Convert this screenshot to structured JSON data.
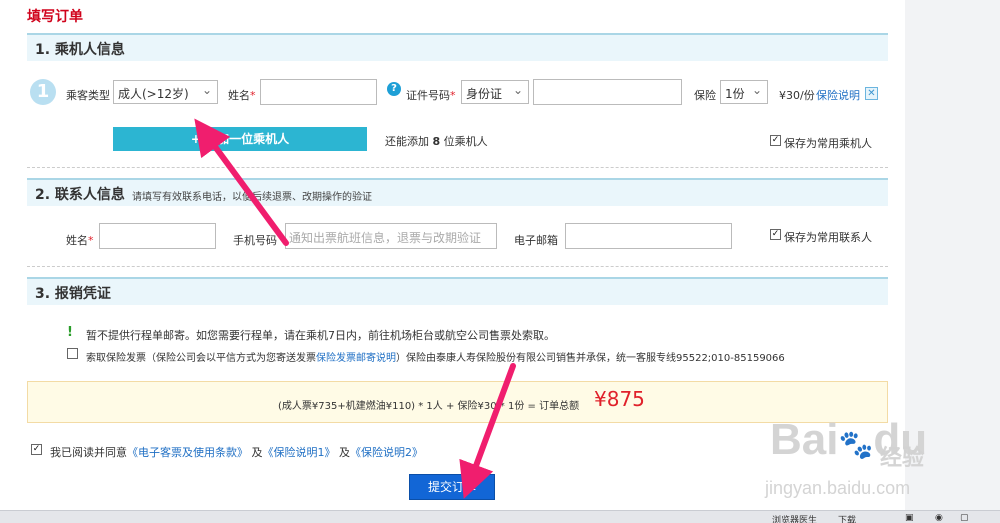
{
  "page": {
    "title": "填写订单"
  },
  "passenger": {
    "section_label": "1. 乘机人信息",
    "step_number": "1",
    "type_label": "乘客类型",
    "type_value": "成人(>12岁)",
    "name_label": "姓名",
    "required_mark": "*",
    "id_label": "证件号码",
    "id_type_value": "身份证",
    "insurance_label": "保险",
    "insurance_value": "1份",
    "insurance_price": "¥30/份",
    "insurance_link": "保险说明",
    "add_button": "添加一位乘机人",
    "add_button_plus": "+",
    "remaining_prefix": "还能添加",
    "remaining_count": "8",
    "remaining_suffix": "位乘机人",
    "save_label": "保存为常用乘机人"
  },
  "contact": {
    "section_label": "2. 联系人信息",
    "section_note": "请填写有效联系电话，以便后续退票、改期操作的验证",
    "name_label": "姓名",
    "phone_label": "手机号码",
    "phone_placeholder": "通知出票航班信息，退票与改期验证",
    "email_label": "电子邮箱",
    "save_label": "保存为常用联系人"
  },
  "receipt": {
    "section_label": "3. 报销凭证",
    "notice_icon": "!",
    "notice": "暂不提供行程单邮寄。如您需要行程单，请在乘机7日内，前往机场柜台或航空公司售票处索取。",
    "invoice_label": "索取保险发票（保险公司会以平信方式为您寄送发票",
    "invoice_link": "保险发票邮寄说明",
    "invoice_suffix": "）保险由泰康人寿保险股份有限公司销售并承保，统一客服专线95522;010-85159066"
  },
  "summary": {
    "formula": "(成人票¥735+机建燃油¥110) * 1人 +  保险¥30 * 1份  = 订单总额",
    "total": "¥875"
  },
  "agreement": {
    "prefix": "我已阅读并同意",
    "link1": "《电子客票及使用条款》",
    "and1": "及",
    "link2": "《保险说明1》",
    "and2": "及",
    "link3": "《保险说明2》"
  },
  "submit_label": "提交订单",
  "watermark": {
    "brand": "Bai",
    "paw": "du",
    "jingyan": "经验",
    "url": "jingyan.baidu.com"
  },
  "taskbar": {
    "item1": "浏览器医生",
    "item2": "下载"
  },
  "colors": {
    "accent": "#d0021b",
    "brand": "#2cb5d2",
    "submit": "#1266d6",
    "arrow": "#f01e6e"
  }
}
